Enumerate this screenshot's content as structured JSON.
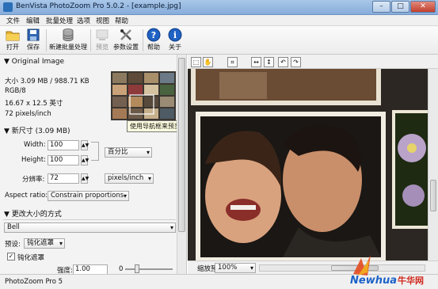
{
  "window": {
    "title": "BenVista PhotoZoom Pro 5.0.2 - [example.jpg]",
    "minimize": "–",
    "maximize": "□",
    "close": "✕"
  },
  "menu": [
    "文件",
    "编辑",
    "批量处理",
    "选项",
    "视图",
    "帮助"
  ],
  "toolbar": {
    "open": "打开",
    "save": "保存",
    "new_batch": "新建批量处理",
    "preview": "预览",
    "settings": "参数设置",
    "help": "帮助",
    "about": "关于"
  },
  "original": {
    "header": "▼ Original Image",
    "size": "大小 3.09 MB / 988.71 KB",
    "mode": "RGB/8",
    "dimensions": "16.67 x 12.5 英寸",
    "resolution": "72 pixels/inch",
    "tooltip": "使用导航框来预览图像的不同部分"
  },
  "newsize": {
    "header": "▼ 新尺寸 (3.09 MB)",
    "width_label": "Width:",
    "width_value": "100",
    "height_label": "Height:",
    "height_value": "100",
    "res_label": "分辨率:",
    "res_value": "72",
    "unit_percent": "百分比",
    "unit_res": "pixels/inch",
    "aspect_label": "Aspect ratio:",
    "aspect_value": "Constrain proportions"
  },
  "resize": {
    "header": "▼ 更改大小的方式",
    "method": "Bell",
    "preset_label": "预设:",
    "preset_value": "钝化遮罩",
    "unsharp_label": "钝化遮罩",
    "strength_label": "强度:",
    "strength_value": "1.00",
    "zero": "0"
  },
  "viewer": {
    "zoom_label": "缩放预览:",
    "zoom_value": "100%"
  },
  "status": "PhotoZoom Pro 5",
  "watermark": {
    "brand": "Newhua",
    "cn": "牛华网"
  },
  "colors": {
    "titlebar": "#87addb",
    "panel": "#f3f3f3",
    "canvas": "#2e2a26"
  }
}
